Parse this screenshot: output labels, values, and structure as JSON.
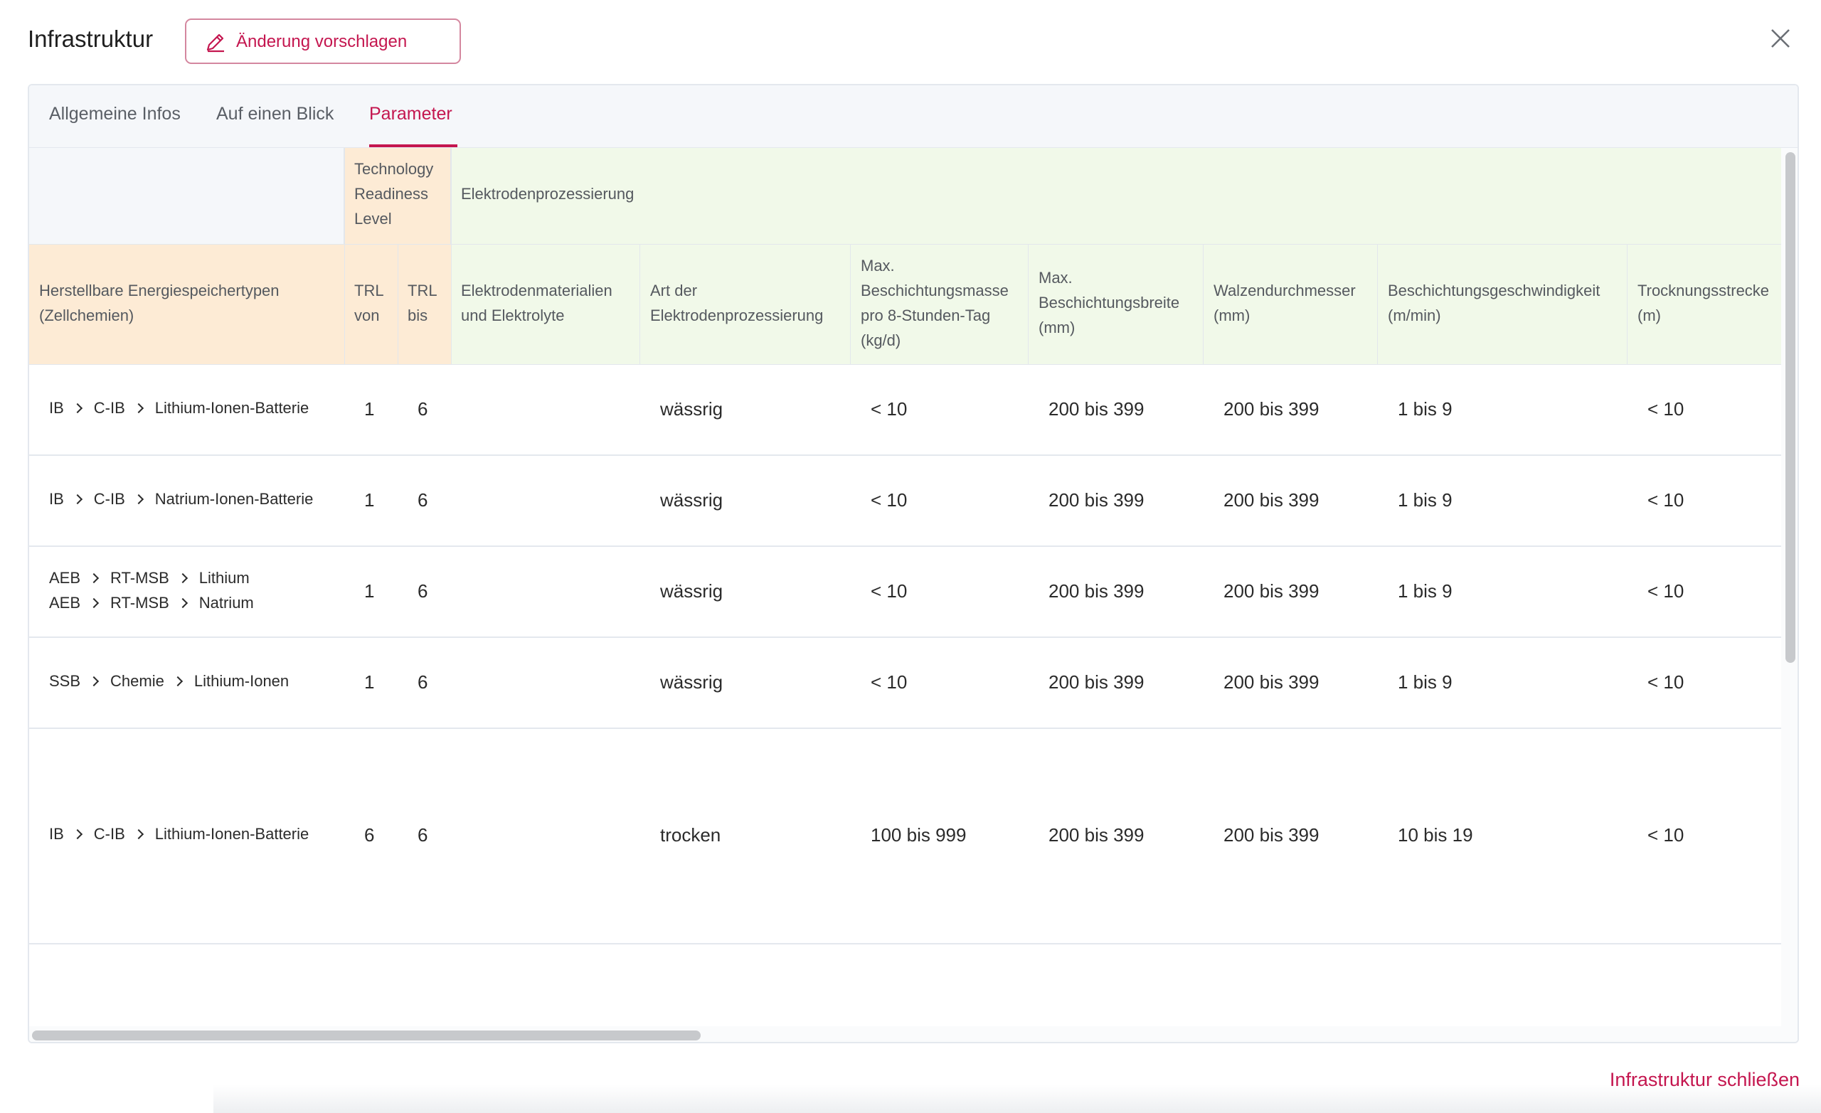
{
  "header": {
    "title": "Infrastruktur",
    "suggest_button": "Änderung vorschlagen"
  },
  "tabs": [
    {
      "label": "Allgemeine Infos",
      "active": false
    },
    {
      "label": "Auf einen Blick",
      "active": false
    },
    {
      "label": "Parameter",
      "active": true
    }
  ],
  "table": {
    "group_headers": {
      "trl": [
        "Technology",
        "Readiness",
        "Level"
      ],
      "elektroden": "Elektrodenprozessierung"
    },
    "columns": {
      "types": [
        "Herstellbare Energiespeichertypen",
        "(Zellchemien)"
      ],
      "trl_von": [
        "TRL",
        "von"
      ],
      "trl_bis": [
        "TRL",
        "bis"
      ],
      "materialien": [
        "Elektrodenmaterialien",
        "und Elektrolyte"
      ],
      "art": [
        "Art der",
        "Elektrodenprozessierung"
      ],
      "masse": [
        "Max.",
        "Beschichtungsmasse",
        "pro 8-Stunden-Tag",
        "(kg/d)"
      ],
      "breite": [
        "Max.",
        "Beschichtungsbreite",
        "(mm)"
      ],
      "walzen": [
        "Walzendurchmesser",
        "(mm)"
      ],
      "geschw": [
        "Beschichtungsgeschwindigkeit",
        "(m/min)"
      ],
      "trocknung": [
        "Trocknungsstrecke",
        "(m)"
      ]
    },
    "rows": [
      {
        "types": [
          [
            "IB",
            "C-IB",
            "Lithium-Ionen-Batterie"
          ]
        ],
        "trl_von": "1",
        "trl_bis": "6",
        "materialien": "",
        "art": "wässrig",
        "masse": "< 10",
        "breite": "200 bis 399",
        "walzen": "200 bis 399",
        "geschw": "1 bis 9",
        "trocknung": "< 10"
      },
      {
        "types": [
          [
            "IB",
            "C-IB",
            "Natrium-Ionen-Batterie"
          ]
        ],
        "trl_von": "1",
        "trl_bis": "6",
        "materialien": "",
        "art": "wässrig",
        "masse": "< 10",
        "breite": "200 bis 399",
        "walzen": "200 bis 399",
        "geschw": "1 bis 9",
        "trocknung": "< 10"
      },
      {
        "types": [
          [
            "AEB",
            "RT-MSB",
            "Lithium"
          ],
          [
            "AEB",
            "RT-MSB",
            "Natrium"
          ]
        ],
        "trl_von": "1",
        "trl_bis": "6",
        "materialien": "",
        "art": "wässrig",
        "masse": "< 10",
        "breite": "200 bis 399",
        "walzen": "200 bis 399",
        "geschw": "1 bis 9",
        "trocknung": "< 10"
      },
      {
        "types": [
          [
            "SSB",
            "Chemie",
            "Lithium-Ionen"
          ]
        ],
        "trl_von": "1",
        "trl_bis": "6",
        "materialien": "",
        "art": "wässrig",
        "masse": "< 10",
        "breite": "200 bis 399",
        "walzen": "200 bis 399",
        "geschw": "1 bis 9",
        "trocknung": "< 10"
      },
      {
        "types": [
          [
            "IB",
            "C-IB",
            "Lithium-Ionen-Batterie"
          ]
        ],
        "trl_von": "6",
        "trl_bis": "6",
        "materialien": "",
        "art": "trocken",
        "masse": "100 bis 999",
        "breite": "200 bis 399",
        "walzen": "200 bis 399",
        "geschw": "10 bis 19",
        "trocknung": "< 10"
      }
    ]
  },
  "footer": {
    "close_label": "Infrastruktur schließen"
  },
  "colors": {
    "accent": "#c4164f",
    "header_orange": "#fdebd5",
    "header_green": "#f1f9e9",
    "header_gray": "#f5f7fa"
  },
  "icons": {
    "suggest": "pencil-icon",
    "close": "close-icon",
    "breadcrumb_separator": "chevron-right-icon"
  }
}
